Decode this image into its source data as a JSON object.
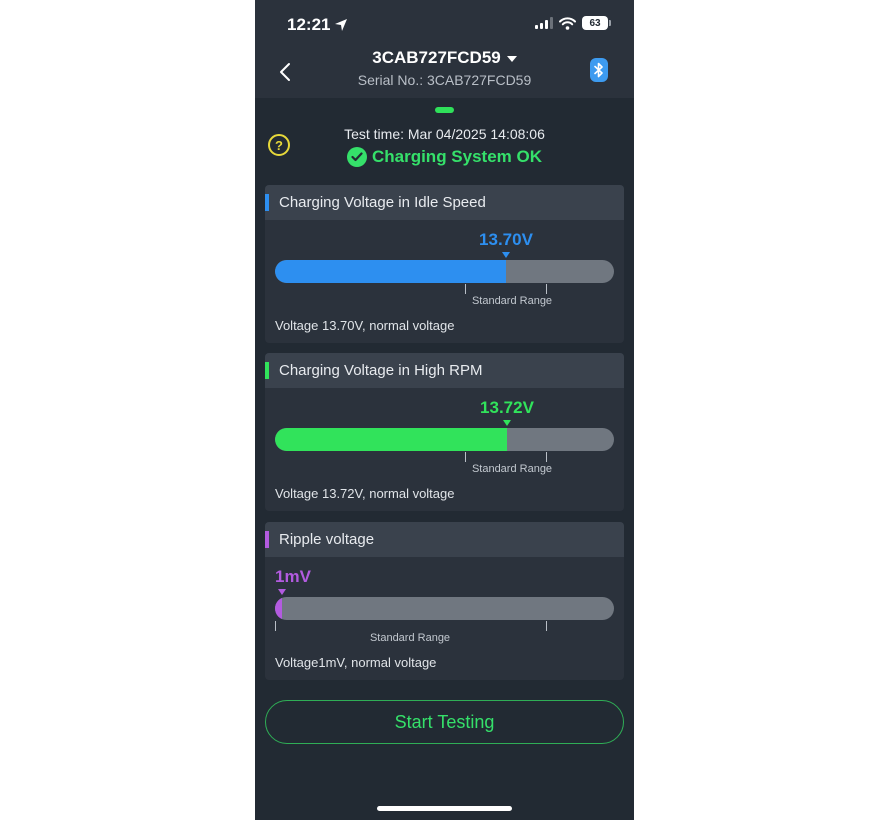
{
  "status_bar": {
    "time": "12:21",
    "battery": "63"
  },
  "header": {
    "device_name": "3CAB727FCD59",
    "serial": "Serial No.: 3CAB727FCD59"
  },
  "summary": {
    "test_time": "Test time: Mar 04/2025 14:08:06",
    "status": "Charging System OK"
  },
  "colors": {
    "background": "#222a33",
    "ok_green": "#35e06a",
    "idle_blue": "#2d8ff0",
    "high_green": "#31e35b",
    "ripple_purple": "#b35be0"
  },
  "cards": [
    {
      "title": "Charging Voltage in Idle Speed",
      "reading": "13.70V",
      "fill_fraction": 0.68,
      "color": "#2d8ff0",
      "range_label": "Standard Range",
      "description": "Voltage 13.70V, normal voltage"
    },
    {
      "title": "Charging Voltage in High RPM",
      "reading": "13.72V",
      "fill_fraction": 0.685,
      "color": "#31e35b",
      "range_label": "Standard Range",
      "description": "Voltage 13.72V, normal voltage"
    },
    {
      "title": "Ripple voltage",
      "reading": "1mV",
      "fill_fraction": 0.02,
      "color": "#b35be0",
      "range_label": "Standard Range",
      "description": "Voltage1mV, normal voltage"
    }
  ],
  "actions": {
    "start_label": "Start Testing"
  },
  "icons": [
    "location-arrow-icon",
    "signal-icon",
    "wifi-icon",
    "battery-icon",
    "back-chevron-icon",
    "dropdown-caret-icon",
    "bluetooth-icon",
    "help-icon",
    "check-circle-icon"
  ]
}
